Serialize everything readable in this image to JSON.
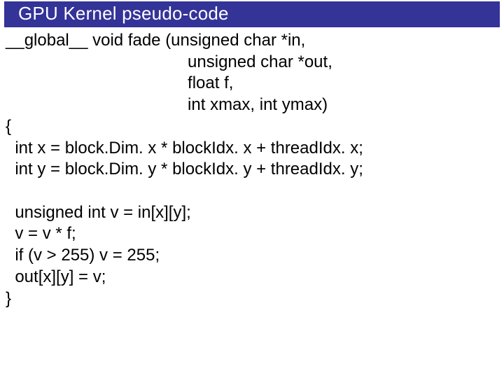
{
  "slide": {
    "title": "GPU Kernel pseudo-code",
    "code_lines": [
      "__global__ void fade (unsigned char *in,",
      "                                       unsigned char *out,",
      "                                       float f,",
      "                                       int xmax, int ymax)",
      "{",
      "  int x = block.Dim. x * blockIdx. x + threadIdx. x;",
      "  int y = block.Dim. y * blockIdx. y + threadIdx. y;",
      "",
      "  unsigned int v = in[x][y];",
      "  v = v * f;",
      "  if (v > 255) v = 255;",
      "  out[x][y] = v;",
      "}"
    ]
  }
}
